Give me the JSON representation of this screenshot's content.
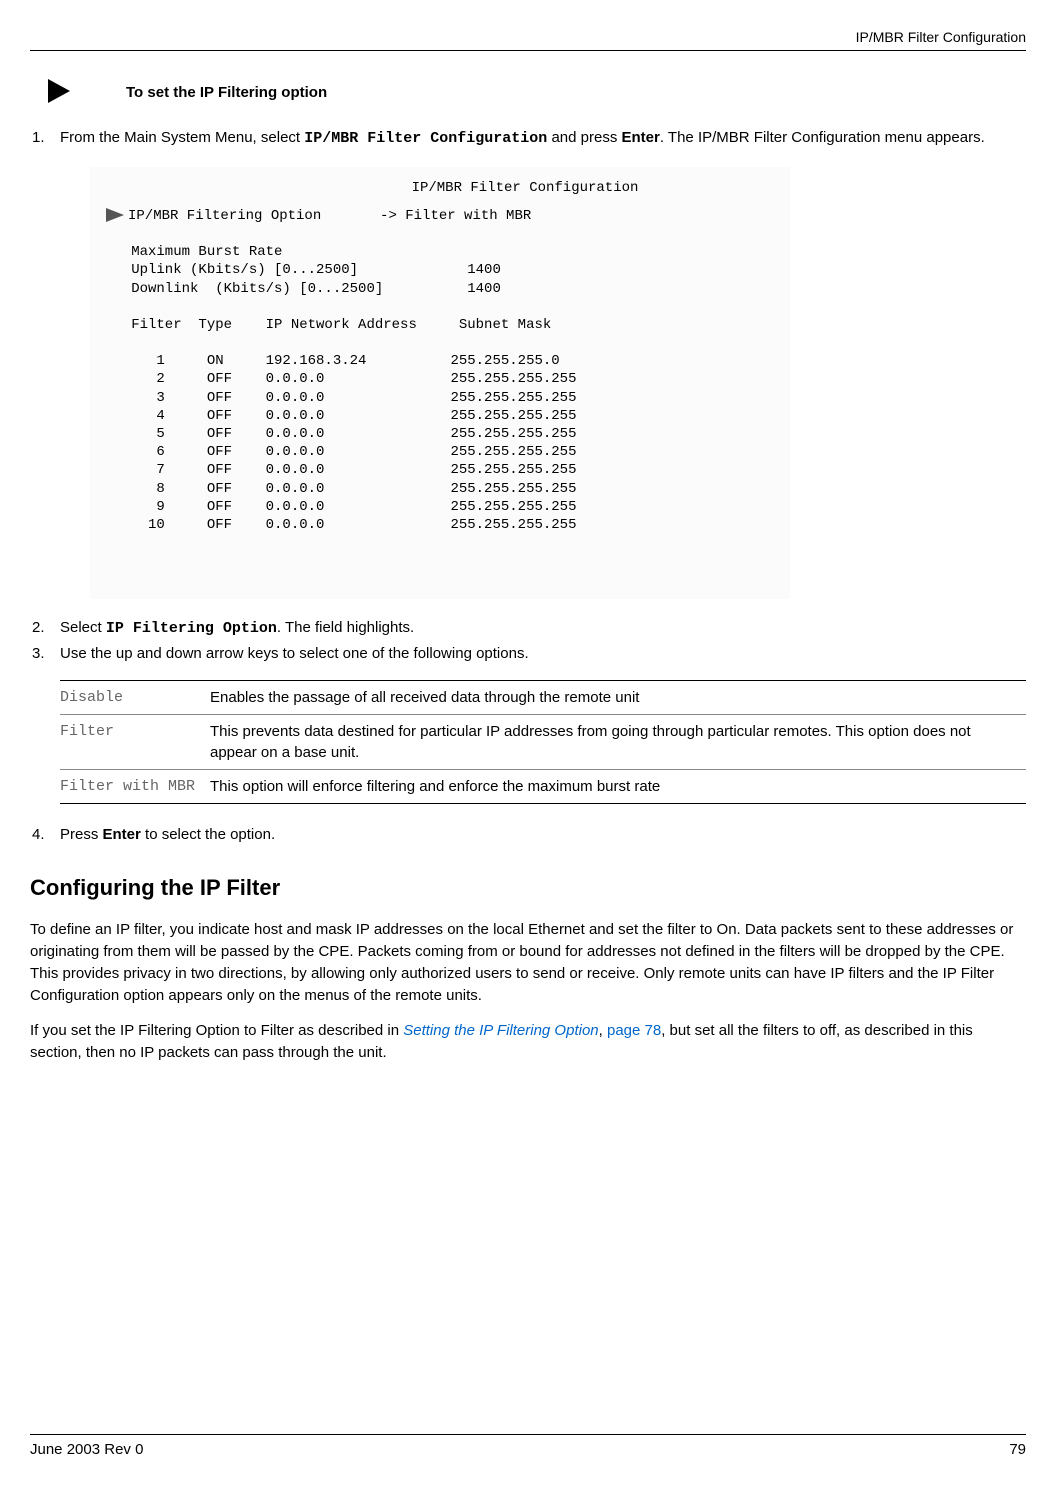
{
  "header": {
    "title": "IP/MBR Filter Configuration"
  },
  "procedure": {
    "title": "To set the IP Filtering option"
  },
  "steps": {
    "s1_prefix": "From the Main System Menu, select ",
    "s1_code": "IP/MBR Filter Configuration",
    "s1_mid": " and press ",
    "s1_bold": "Enter",
    "s1_suffix": ". The IP/MBR Filter Configuration menu appears.",
    "s2_prefix": "Select ",
    "s2_code": "IP Filtering Option",
    "s2_suffix": ". The field highlights.",
    "s3": "Use the up and down arrow keys to select one of the following options.",
    "s4_prefix": "Press ",
    "s4_bold": "Enter",
    "s4_suffix": " to select the option."
  },
  "screenshot": {
    "title": "IP/MBR Filter Configuration",
    "line_option": "IP/MBR Filtering Option       -> Filter with MBR",
    "line_blank": " ",
    "line_mbr_header": "   Maximum Burst Rate",
    "line_uplink": "   Uplink (Kbits/s) [0...2500]             1400",
    "line_downlink": "   Downlink  (Kbits/s) [0...2500]          1400",
    "line_table_header": "   Filter  Type    IP Network Address     Subnet Mask",
    "rows": {
      "r1": "      1     ON     192.168.3.24          255.255.255.0",
      "r2": "      2     OFF    0.0.0.0               255.255.255.255",
      "r3": "      3     OFF    0.0.0.0               255.255.255.255",
      "r4": "      4     OFF    0.0.0.0               255.255.255.255",
      "r5": "      5     OFF    0.0.0.0               255.255.255.255",
      "r6": "      6     OFF    0.0.0.0               255.255.255.255",
      "r7": "      7     OFF    0.0.0.0               255.255.255.255",
      "r8": "      8     OFF    0.0.0.0               255.255.255.255",
      "r9": "      9     OFF    0.0.0.0               255.255.255.255",
      "r10": "     10     OFF    0.0.0.0               255.255.255.255"
    }
  },
  "options": {
    "opt1_name": "Disable",
    "opt1_desc": "Enables the passage of all received data through the remote unit",
    "opt2_name": "Filter",
    "opt2_desc": "This prevents data destined for particular IP addresses from going through particular remotes. This option does not appear on a base unit.",
    "opt3_name": "Filter with MBR",
    "opt3_desc": "This option will enforce filtering and enforce the maximum burst rate"
  },
  "section": {
    "heading": "Configuring the IP Filter",
    "p1": "To define an IP filter, you indicate host and mask IP addresses on the local Ethernet and set the filter to On. Data packets sent to these addresses or originating from them will be passed by the CPE. Packets coming from or bound for addresses not defined in the filters will be dropped by the CPE. This provides privacy in two directions, by allowing only authorized users to send or receive. Only remote units can have IP filters and the IP Filter Configuration option appears only on the menus of the remote units.",
    "p2_prefix": "If you set the IP Filtering Option to Filter as described in ",
    "p2_link": "Setting the IP Filtering Option",
    "p2_mid": ", ",
    "p2_page": "page 78",
    "p2_suffix": ", but set all the filters to off, as described in this section, then no IP packets can pass through the unit."
  },
  "footer": {
    "left": "June 2003 Rev 0",
    "right": "79"
  }
}
